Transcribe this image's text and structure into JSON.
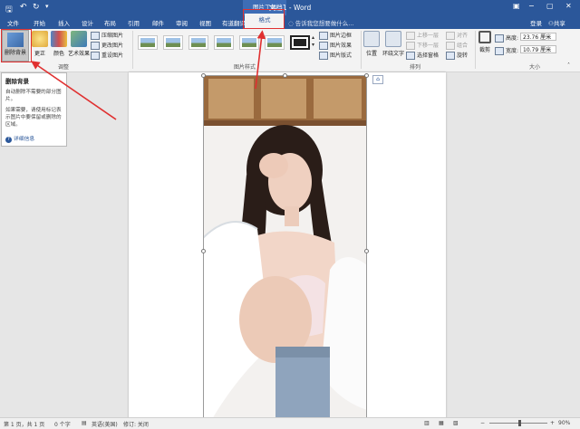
{
  "titlebar": {
    "doc_title": "文档1 - Word",
    "tool_tab_title": "图片工具",
    "controls": [
      "−",
      "▢",
      "✕"
    ]
  },
  "tabs": [
    "文件",
    "开始",
    "插入",
    "设计",
    "布局",
    "引用",
    "邮件",
    "审阅",
    "视图",
    "有道翻译"
  ],
  "format_tab": "格式",
  "tell_me": "告诉我您想要做什么...",
  "login": "登录",
  "share": "共享",
  "ribbon": {
    "remove_bg": "删除背景",
    "corrections": "更正",
    "color": "颜色",
    "artistic": "艺术效果",
    "compress": "压缩图片",
    "change_pic": "更改图片",
    "reset_pic": "重设图片",
    "group_adjust": "调整",
    "group_styles": "图片样式",
    "border": "图片边框",
    "effects": "图片效果",
    "layout": "图片版式",
    "position": "位置",
    "wrap_text": "环绕文字",
    "bring_forward": "上移一层",
    "send_backward": "下移一层",
    "selection_pane": "选择窗格",
    "align": "对齐",
    "group": "组合",
    "rotate": "旋转",
    "group_arrange": "排列",
    "crop": "裁剪",
    "height_label": "高度:",
    "height_value": "23.76 厘米",
    "width_label": "宽度:",
    "width_value": "10.79 厘米",
    "group_size": "大小"
  },
  "tooltip": {
    "title": "删除背景",
    "line1": "自动删除不需要的部分图片。",
    "line2": "如果需要，请使用标记表示图片中要保留或删除的区域。",
    "more": "详细信息"
  },
  "statusbar": {
    "page": "第 1 页，共 1 页",
    "words": "0 个字",
    "lang": "英语(美国)",
    "revisions": "修订: 关闭",
    "zoom": "90%"
  },
  "colors": {
    "accent": "#2b579a",
    "highlight": "#e03030"
  }
}
